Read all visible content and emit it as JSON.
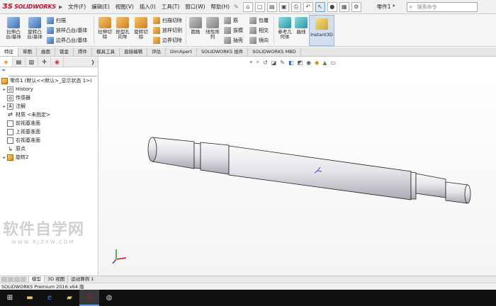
{
  "app": {
    "logo_brand": "SOLIDWORKS",
    "logo_ds": "ƷS",
    "document_name": "零件1 *",
    "search_placeholder": "搜索命令"
  },
  "menu": [
    "文件(F)",
    "编辑(E)",
    "视图(V)",
    "插入(I)",
    "工具(T)",
    "窗口(W)",
    "帮助(H)"
  ],
  "ribbon": {
    "extrude_boss": "拉伸凸\n台/基体",
    "revolve_boss": "旋转凸\n台/基体",
    "sweep": "扫描",
    "loft_boss": "放样凸台/基体",
    "boundary_boss": "边界凸台/基体",
    "extrude_cut": "拉伸切\n除",
    "hole_wizard": "异型孔\n向导",
    "revolve_cut": "旋转切\n除",
    "sweep_cut": "扫描切除",
    "loft_cut": "放样切割",
    "boundary_cut": "边界切除",
    "fillet": "圆角",
    "linear_pattern": "线性阵\n列",
    "rib": "筋",
    "draft": "拔模",
    "shell": "抽壳",
    "wrap": "包覆",
    "intersect": "相交",
    "mirror": "镜向",
    "reference_geometry": "参考几\n何体",
    "curves": "曲线",
    "instant3d": "Instant3D"
  },
  "tabs": [
    "特征",
    "草图",
    "曲面",
    "钣金",
    "焊件",
    "模具工具",
    "直接编辑",
    "评估",
    "DimXpert",
    "SOLIDWORKS 插件",
    "SOLIDWORKS MBD"
  ],
  "feature_tree": {
    "root": "零件1 (默认<<默认>_显示状态 1>)",
    "items": [
      {
        "label": "History",
        "icon": "history-icon",
        "expandable": true
      },
      {
        "label": "传感器",
        "icon": "sensor-icon",
        "expandable": false
      },
      {
        "label": "注解",
        "icon": "annotation-icon",
        "expandable": true
      },
      {
        "label": "材质 <未指定>",
        "icon": "material-icon",
        "expandable": false
      },
      {
        "label": "前视基准面",
        "icon": "plane-icon",
        "expandable": false
      },
      {
        "label": "上视基准面",
        "icon": "plane-icon",
        "expandable": false
      },
      {
        "label": "右视基准面",
        "icon": "plane-icon",
        "expandable": false
      },
      {
        "label": "原点",
        "icon": "origin-icon",
        "expandable": false
      },
      {
        "label": "旋转2",
        "icon": "revolve-feature-icon",
        "expandable": true
      }
    ]
  },
  "watermark": {
    "text": "软件自学网",
    "url_text": "WWW.RJZXW.COM"
  },
  "bottom_tabs": [
    "模型",
    "3D 视图",
    "运动算例 1"
  ],
  "status_bar": "SOLIDWORKS Premium 2016 x64 版",
  "colors": {
    "accent": "#3f6fb3",
    "brand": "#c8102e",
    "selected_tab": "#ffffff"
  }
}
